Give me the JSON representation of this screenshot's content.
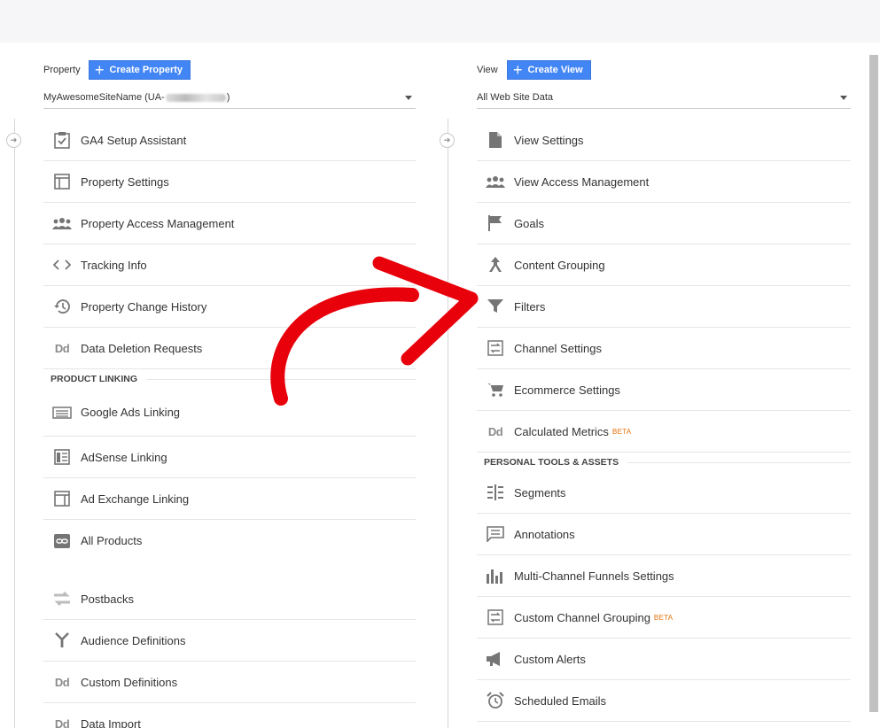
{
  "property": {
    "label": "Property",
    "create_label": "Create Property",
    "selected_prefix": "MyAwesomeSiteName (UA-",
    "selected_suffix": ")",
    "items_top": [
      {
        "label": "GA4 Setup Assistant",
        "icon": "checklist-icon"
      },
      {
        "label": "Property Settings",
        "icon": "property-settings-icon"
      },
      {
        "label": "Property Access Management",
        "icon": "people-icon"
      },
      {
        "label": "Tracking Info",
        "icon": "code-icon"
      },
      {
        "label": "Property Change History",
        "icon": "history-icon"
      },
      {
        "label": "Data Deletion Requests",
        "icon": "dd-icon"
      }
    ],
    "section_label": "PRODUCT LINKING",
    "items_linking": [
      {
        "label": "Google Ads Linking",
        "icon": "ads-icon"
      },
      {
        "label": "AdSense Linking",
        "icon": "adsense-icon"
      },
      {
        "label": "Ad Exchange Linking",
        "icon": "adexchange-icon"
      },
      {
        "label": "All Products",
        "icon": "link-icon"
      }
    ],
    "items_bottom": [
      {
        "label": "Postbacks",
        "icon": "postbacks-icon"
      },
      {
        "label": "Audience Definitions",
        "icon": "audience-icon"
      },
      {
        "label": "Custom Definitions",
        "icon": "dd-icon"
      },
      {
        "label": "Data Import",
        "icon": "dd-icon"
      }
    ]
  },
  "view": {
    "label": "View",
    "create_label": "Create View",
    "selected": "All Web Site Data",
    "items_top": [
      {
        "label": "View Settings",
        "icon": "document-icon"
      },
      {
        "label": "View Access Management",
        "icon": "people-icon"
      },
      {
        "label": "Goals",
        "icon": "flag-icon"
      },
      {
        "label": "Content Grouping",
        "icon": "content-grouping-icon"
      },
      {
        "label": "Filters",
        "icon": "filter-icon"
      },
      {
        "label": "Channel Settings",
        "icon": "channel-icon"
      },
      {
        "label": "Ecommerce Settings",
        "icon": "cart-icon"
      },
      {
        "label": "Calculated Metrics",
        "icon": "dd-icon",
        "badge": "BETA"
      }
    ],
    "section_label": "PERSONAL TOOLS & ASSETS",
    "items_personal": [
      {
        "label": "Segments",
        "icon": "segments-icon"
      },
      {
        "label": "Annotations",
        "icon": "annotations-icon"
      },
      {
        "label": "Multi-Channel Funnels Settings",
        "icon": "bar-chart-icon"
      },
      {
        "label": "Custom Channel Grouping",
        "icon": "channel-icon",
        "badge": "BETA"
      },
      {
        "label": "Custom Alerts",
        "icon": "megaphone-icon"
      },
      {
        "label": "Scheduled Emails",
        "icon": "alarm-icon"
      }
    ]
  },
  "colors": {
    "accent": "#4285f4",
    "beta": "#e8710a",
    "annotation_arrow": "#e8000b"
  }
}
